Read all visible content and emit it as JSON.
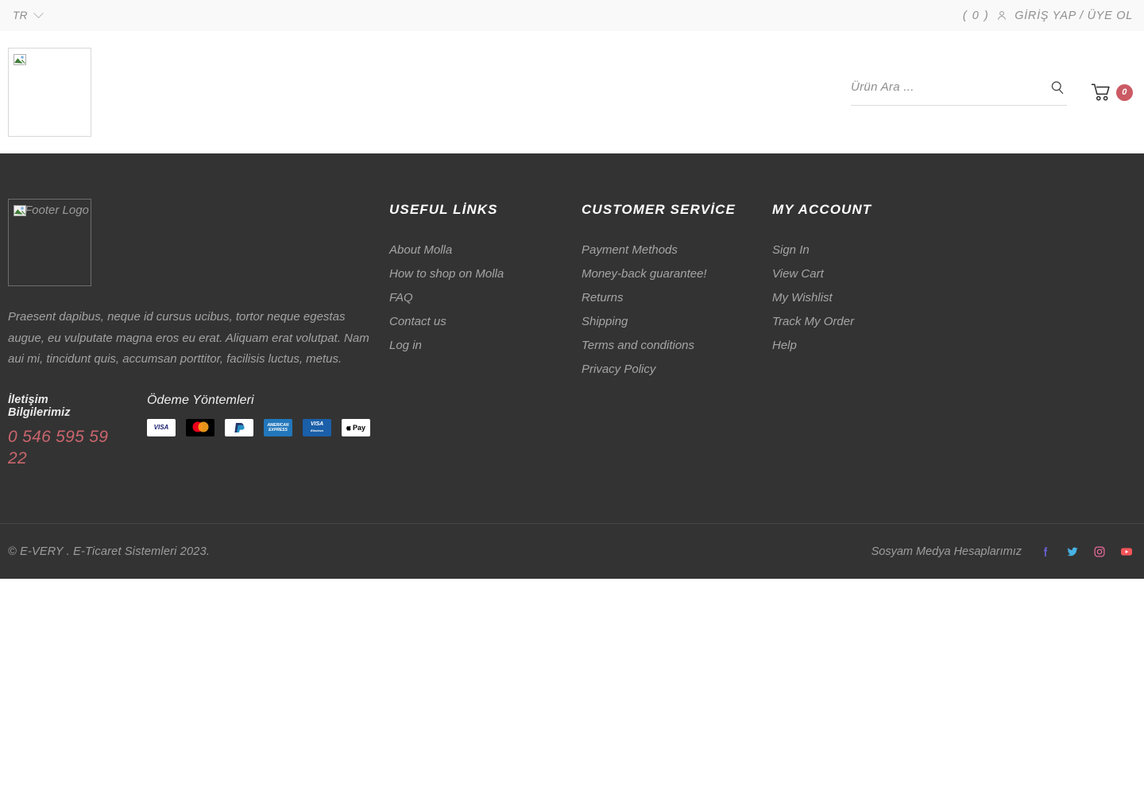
{
  "topbar": {
    "language": "TR",
    "language_icon": "chevron-down-icon",
    "wishlist_count": "( 0 )",
    "account_icon": "person-icon",
    "account_label": "GİRİŞ YAP / ÜYE OL"
  },
  "header": {
    "logo_alt": "",
    "search": {
      "placeholder": "Ürün Ara ...",
      "value": "",
      "icon": "search-icon"
    },
    "cart": {
      "icon": "shopping-cart-icon",
      "count": "0"
    }
  },
  "footer": {
    "logo_alt": "Footer Logo",
    "about": "Praesent dapibus, neque id cursus ucibus, tortor neque egestas augue, eu vulputate magna eros eu erat. Aliquam erat volutpat. Nam aui mi, tincidunt quis, accumsan porttitor, facilisis luctus, metus.",
    "contact": {
      "title": "İletişim Bilgilerimiz",
      "phone": "0 546 595 59 22"
    },
    "payment": {
      "title": "Ödeme Yöntemleri",
      "methods": [
        {
          "name": "visa",
          "label": "VISA"
        },
        {
          "name": "mastercard",
          "label": "mastercard"
        },
        {
          "name": "paypal",
          "label": "PayPal"
        },
        {
          "name": "american-express",
          "label": "AMERICAN EXPRESS"
        },
        {
          "name": "visa-electron",
          "label": "VISA Electron"
        },
        {
          "name": "apple-pay",
          "label": "Pay"
        }
      ]
    },
    "columns": [
      {
        "heading": "USEFUL LİNKS",
        "links": [
          "About Molla",
          "How to shop on Molla",
          "FAQ",
          "Contact us",
          "Log in"
        ]
      },
      {
        "heading": "CUSTOMER SERVİCE",
        "links": [
          "Payment Methods",
          "Money-back guarantee!",
          "Returns",
          "Shipping",
          "Terms and conditions",
          "Privacy Policy"
        ]
      },
      {
        "heading": "MY ACCOUNT",
        "links": [
          "Sign In",
          "View Cart",
          "My Wishlist",
          "Track My Order",
          "Help"
        ]
      }
    ],
    "bottom": {
      "copyright": "© E-VERY . E-Ticaret Sistemleri 2023.",
      "social_label": "Sosyam Medya Hesaplarımız",
      "socials": [
        {
          "name": "facebook-icon",
          "color": "#6a62d8"
        },
        {
          "name": "twitter-icon",
          "color": "#46b3e6"
        },
        {
          "name": "instagram-icon",
          "color": "#e86a97"
        },
        {
          "name": "youtube-icon",
          "color": "#f2555a"
        }
      ]
    }
  },
  "colors": {
    "footer_bg": "#333333",
    "accent": "#c9656d",
    "topbar_bg": "#f9f9f9"
  }
}
